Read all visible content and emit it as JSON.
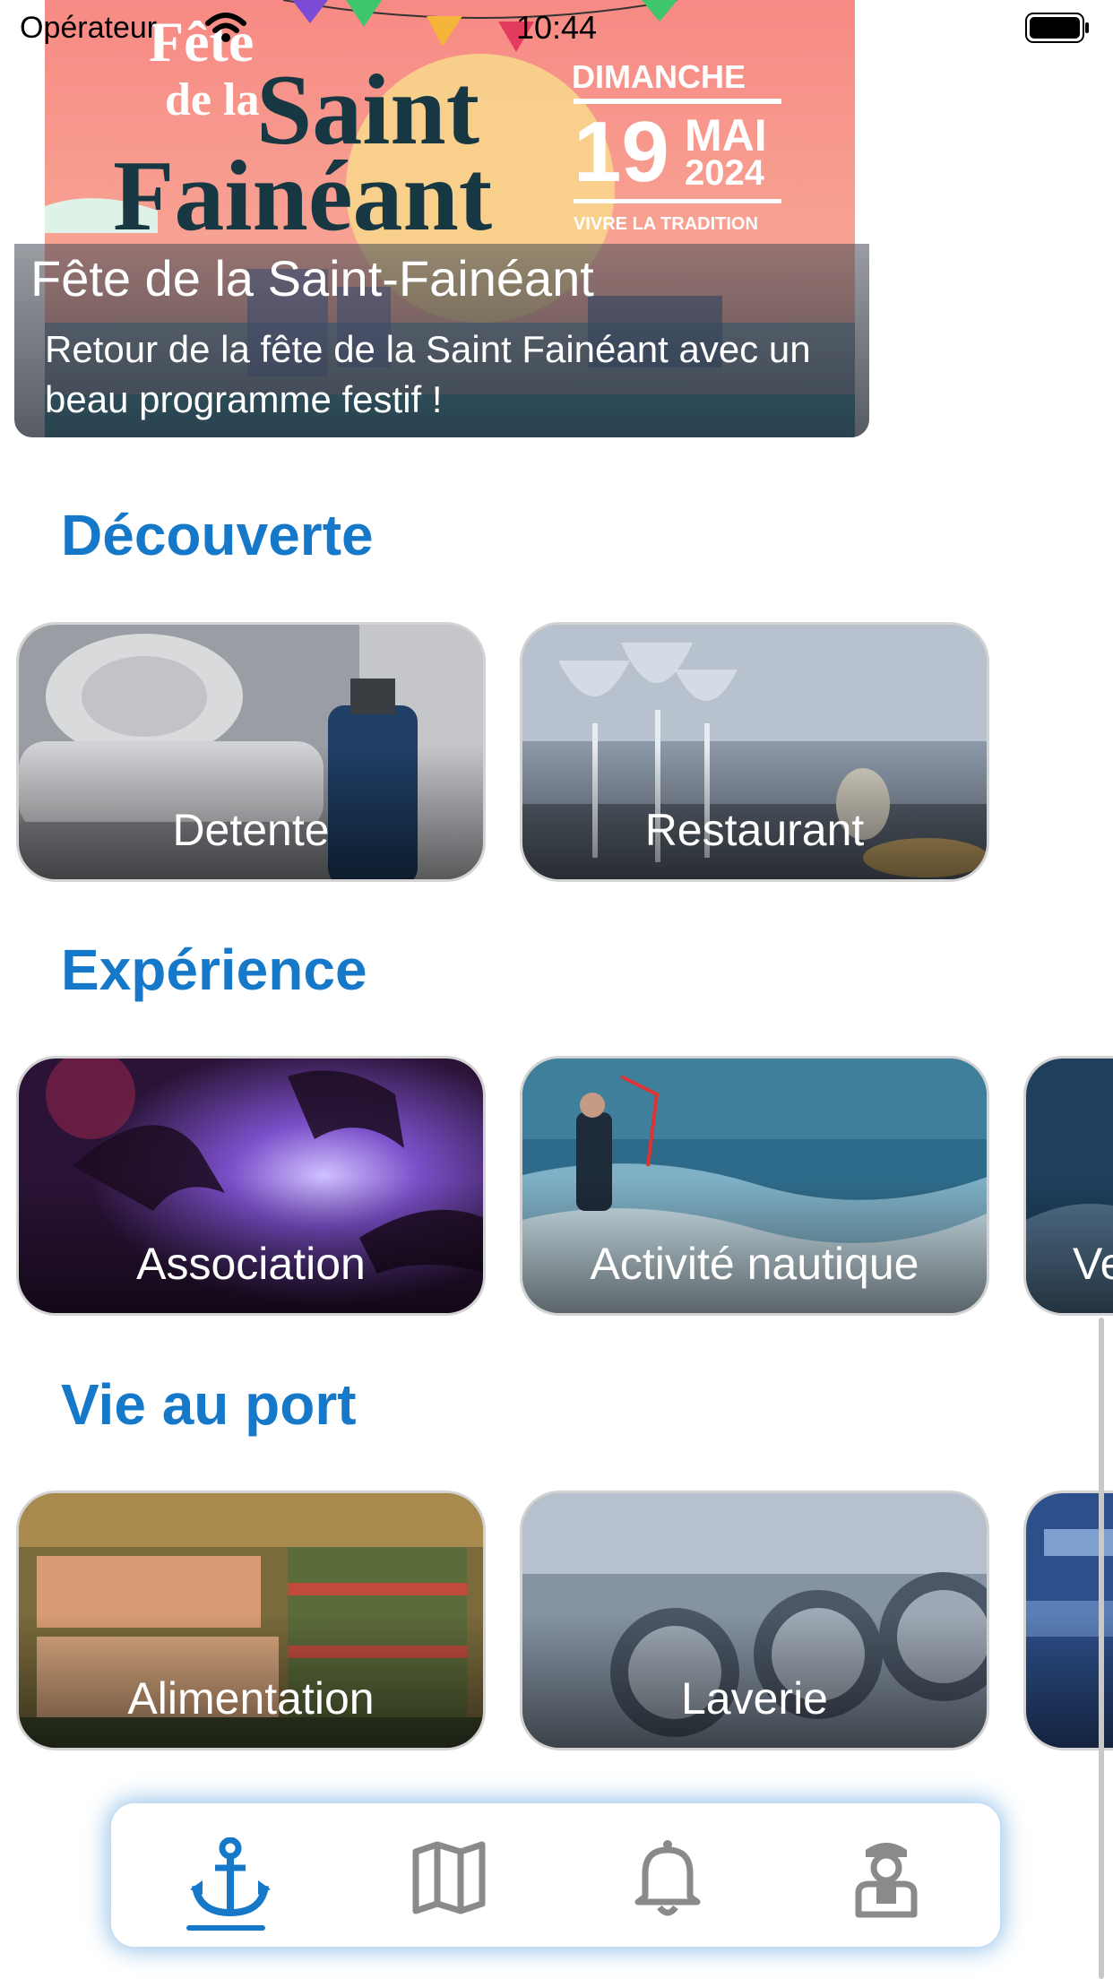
{
  "status": {
    "carrier": "Opérateur",
    "time": "10:44"
  },
  "hero": {
    "title": "Fête de la Saint-Fainéant",
    "subtitle": "Retour de la fête de la Saint Fainéant avec un beau programme festif !",
    "poster": {
      "line1": "Fête",
      "line2": "de la",
      "line3": "Saint",
      "line4": "Fainéant",
      "day": "DIMANCHE",
      "date": "19",
      "month": "MAI",
      "year": "2024",
      "tagline": "VIVRE LA TRADITION"
    }
  },
  "sections": [
    {
      "title": "Découverte",
      "cards": [
        "Detente",
        "Restaurant"
      ]
    },
    {
      "title": "Expérience",
      "cards": [
        "Association",
        "Activité nautique",
        "Ve"
      ]
    },
    {
      "title": "Vie au port",
      "cards": [
        "Alimentation",
        "Laverie",
        ""
      ]
    }
  ],
  "tabs": [
    {
      "icon": "anchor-icon",
      "active": true
    },
    {
      "icon": "map-icon",
      "active": false
    },
    {
      "icon": "bell-icon",
      "active": false
    },
    {
      "icon": "captain-icon",
      "active": false
    }
  ],
  "colors": {
    "accent": "#1578c9",
    "inactive": "#8a8a8a"
  }
}
